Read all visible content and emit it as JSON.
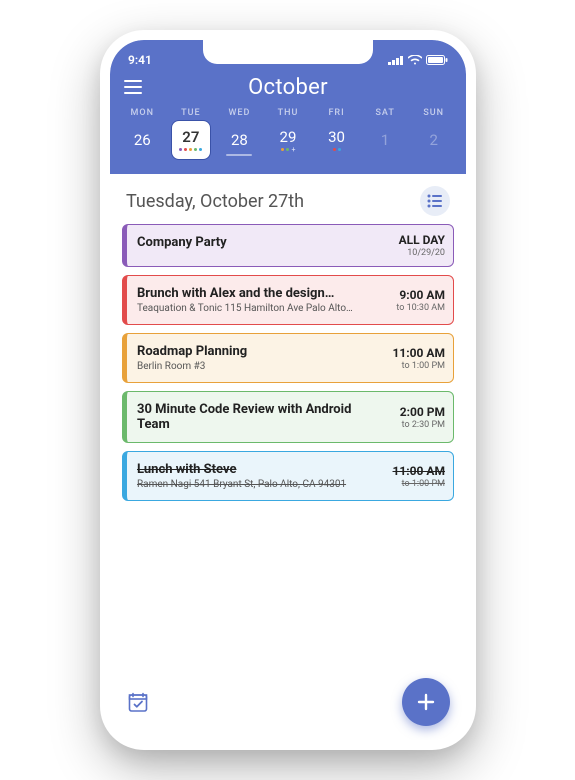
{
  "status": {
    "time": "9:41"
  },
  "header": {
    "title": "October"
  },
  "week": {
    "labels": [
      "MON",
      "TUE",
      "WED",
      "THU",
      "FRI",
      "SAT",
      "SUN"
    ],
    "days": [
      "26",
      "27",
      "28",
      "29",
      "30",
      "1",
      "2"
    ]
  },
  "day_heading": "Tuesday, October 27th",
  "events": [
    {
      "title": "Company Party",
      "subtitle": "",
      "time1": "ALL DAY",
      "time2": "10/29/20",
      "color": "#8A5BB8",
      "bg": "#F1E9F7",
      "cancelled": false
    },
    {
      "title": "Brunch with Alex and the design…",
      "subtitle": "Teaquation & Tonic 115 Hamilton Ave Palo Alto…",
      "time1": "9:00 AM",
      "time2": "to 10:30 AM",
      "color": "#E24B4B",
      "bg": "#FCEBEB",
      "cancelled": false
    },
    {
      "title": "Roadmap Planning",
      "subtitle": "Berlin Room #3",
      "time1": "11:00 AM",
      "time2": "to 1:00 PM",
      "color": "#E8A13A",
      "bg": "#FCF3E5",
      "cancelled": false
    },
    {
      "title": "30 Minute Code Review with Android Team",
      "subtitle": "",
      "time1": "2:00 PM",
      "time2": "to 2:30 PM",
      "color": "#6BB96B",
      "bg": "#EEF7EE",
      "cancelled": false
    },
    {
      "title": "Lunch with Steve",
      "subtitle": "Ramen Nagi 541 Bryant St, Palo Alto, CA 94301",
      "time1": "11:00 AM",
      "time2": "to 1:00 PM",
      "color": "#3AA8E0",
      "bg": "#EAF5FB",
      "cancelled": true
    }
  ],
  "dot_colors": {
    "purple": "#8A5BB8",
    "red": "#E24B4B",
    "orange": "#E8A13A",
    "green": "#6BB96B",
    "blue": "#3AA8E0"
  }
}
